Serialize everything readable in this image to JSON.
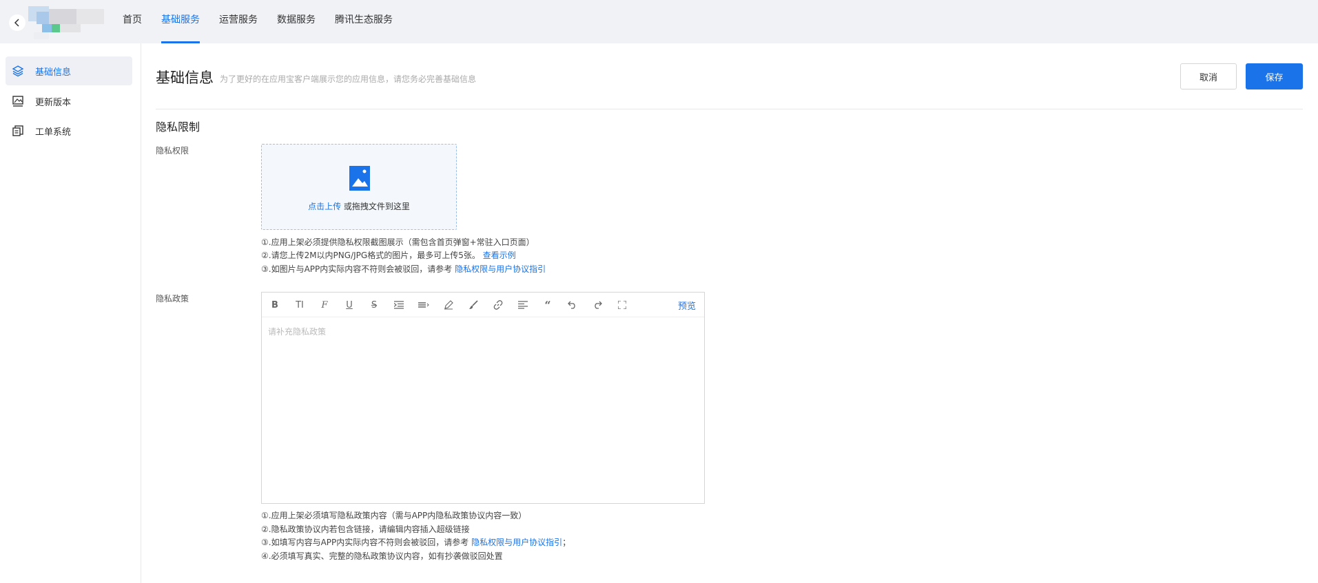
{
  "nav": {
    "items": [
      {
        "label": "首页",
        "active": false
      },
      {
        "label": "基础服务",
        "active": true
      },
      {
        "label": "运营服务",
        "active": false
      },
      {
        "label": "数据服务",
        "active": false
      },
      {
        "label": "腾讯生态服务",
        "active": false
      }
    ]
  },
  "sidebar": {
    "items": [
      {
        "label": "基础信息",
        "icon": "layers-icon",
        "active": true
      },
      {
        "label": "更新版本",
        "icon": "image-frame-icon",
        "active": false
      },
      {
        "label": "工单系统",
        "icon": "copy-document-icon",
        "active": false
      }
    ]
  },
  "header": {
    "title": "基础信息",
    "subtitle": "为了更好的在应用宝客户端展示您的应用信息，请您务必完善基础信息",
    "cancel_label": "取消",
    "save_label": "保存"
  },
  "section": {
    "title": "隐私限制",
    "privacy_permission": {
      "label": "隐私权限",
      "upload_link": "点击上传",
      "upload_text": " 或拖拽文件到这里",
      "hint1": "①.应用上架必须提供隐私权限截图展示（需包含首页弹窗+常驻入口页面）",
      "hint2": "②.请您上传2M以内PNG/JPG格式的图片，最多可上传5张。",
      "hint2_link": "查看示例",
      "hint3": "③.如图片与APP内实际内容不符则会被驳回，请参考 ",
      "hint3_link": "隐私权限与用户协议指引"
    },
    "privacy_policy": {
      "label": "隐私政策",
      "preview_label": "预览",
      "placeholder": "请补充隐私政策",
      "hint1": "①.应用上架必须填写隐私政策内容（需与APP内隐私政策协议内容一致）",
      "hint2": "②.隐私政策协议内若包含链接，请编辑内容插入超级链接",
      "hint3": "③.如填写内容与APP内实际内容不符则会被驳回，请参考 ",
      "hint3_link": "隐私权限与用户协议指引",
      "hint3_suffix": "；",
      "hint4": "④.必须填写真实、完整的隐私政策协议内容，如有抄袭做驳回处置"
    }
  },
  "colors": {
    "accent": "#1a73e8",
    "topbar_bg": "#f1f2f6"
  }
}
